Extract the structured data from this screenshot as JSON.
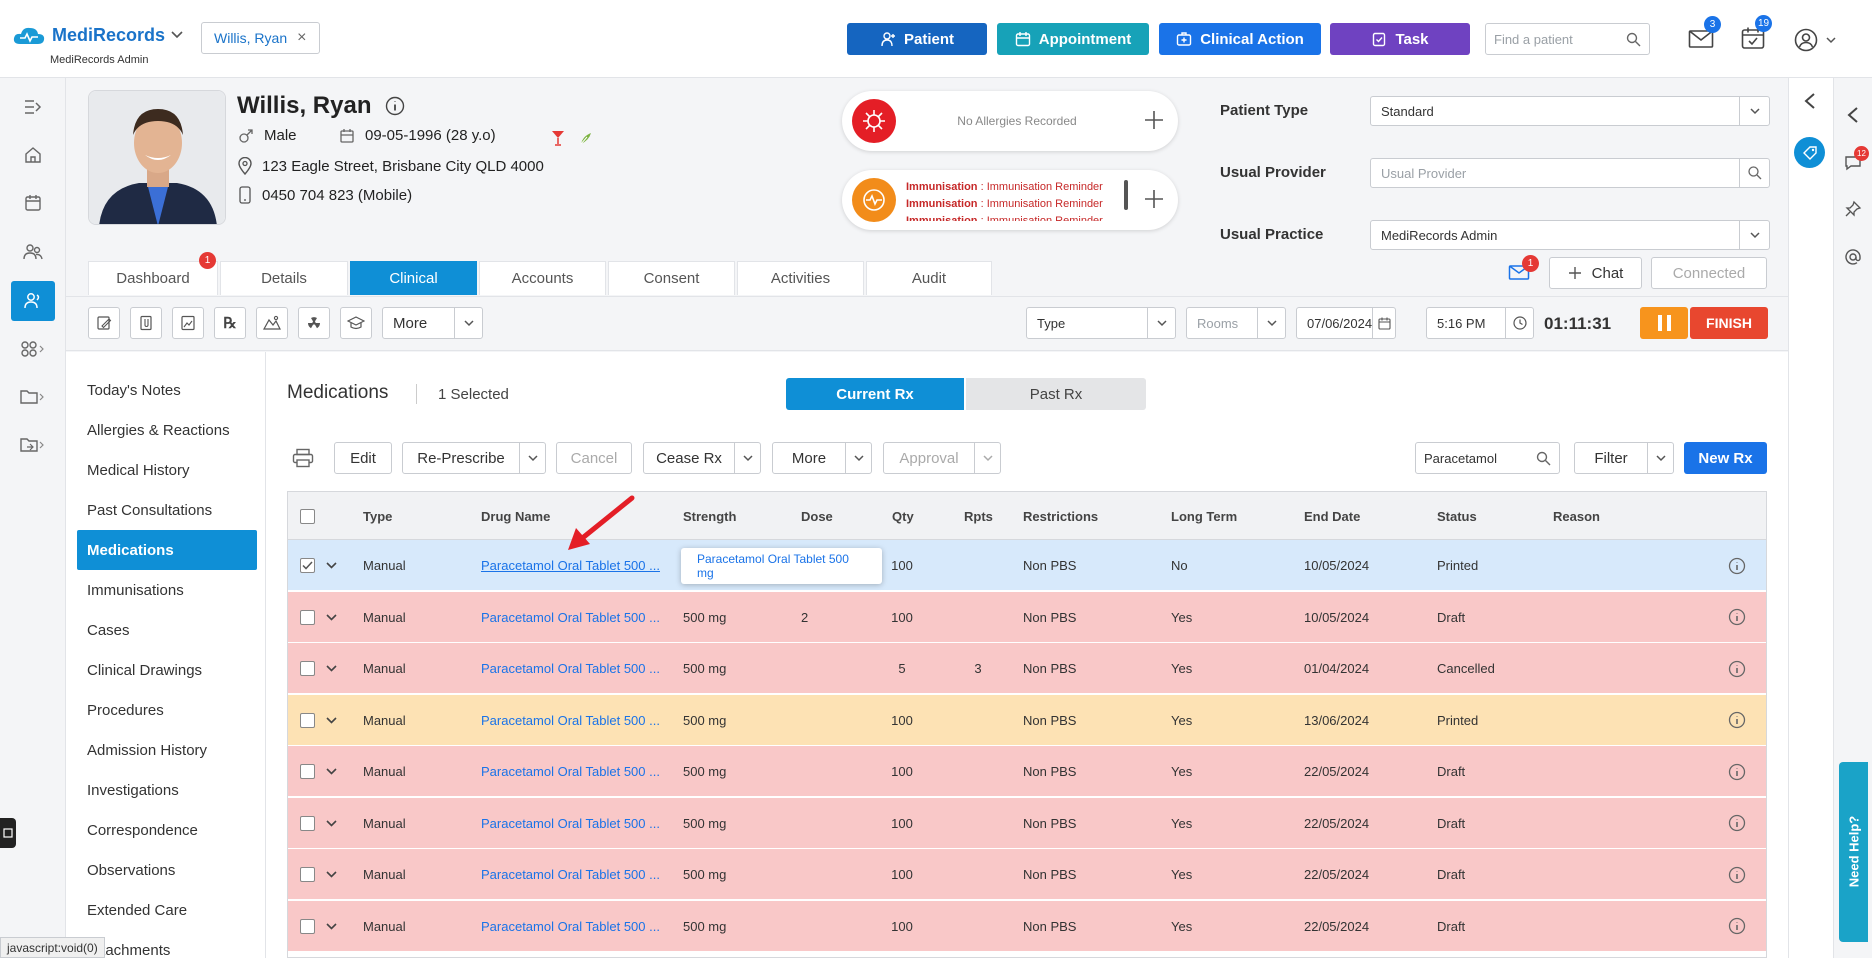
{
  "topbar": {
    "brand_name": "MediRecords",
    "brand_sub": "MediRecords Admin",
    "patient_chip": "Willis, Ryan",
    "buttons": {
      "patient": "Patient",
      "appointment": "Appointment",
      "clinical_action": "Clinical Action",
      "task": "Task"
    },
    "find_placeholder": "Find a patient",
    "mail_badge": "3",
    "tasks_badge": "19",
    "colors": {
      "patient": "#1565c0",
      "appointment": "#17a2b8",
      "clinical_action": "#1a73e8",
      "task": "#6f42c1"
    }
  },
  "patient": {
    "name": "Willis, Ryan",
    "gender": "Male",
    "dob": "09-05-1996 (28 y.o)",
    "address": "123 Eagle Street, Brisbane City QLD 4000",
    "phone": "0450 704 823 (Mobile)",
    "allergies_text": "No Allergies Recorded",
    "immunisation_label": "Immunisation",
    "immunisation_sep": " : ",
    "immunisation_text": "Immunisation Reminder",
    "form": {
      "patient_type_label": "Patient Type",
      "patient_type_value": "Standard",
      "usual_provider_label": "Usual Provider",
      "usual_provider_placeholder": "Usual Provider",
      "usual_practice_label": "Usual Practice",
      "usual_practice_value": "MediRecords Admin"
    }
  },
  "tabs": [
    {
      "label": "Dashboard",
      "badge": "1"
    },
    {
      "label": "Details"
    },
    {
      "label": "Clinical"
    },
    {
      "label": "Accounts"
    },
    {
      "label": "Consent"
    },
    {
      "label": "Activities"
    },
    {
      "label": "Audit"
    }
  ],
  "chat": {
    "inbox_badge": "1",
    "chat_label": "Chat",
    "connected_label": "Connected"
  },
  "toolbar": {
    "more_label": "More",
    "type_label": "Type",
    "rooms_label": "Rooms",
    "date": "07/06/2024",
    "time": "5:16 PM",
    "timer": "01:11:31",
    "finish_label": "FINISH"
  },
  "leftnav": [
    "Today's Notes",
    "Allergies & Reactions",
    "Medical History",
    "Past Consultations",
    "Medications",
    "Immunisations",
    "Cases",
    "Clinical Drawings",
    "Procedures",
    "Admission History",
    "Investigations",
    "Correspondence",
    "Observations",
    "Extended Care",
    "Attachments"
  ],
  "medications": {
    "title": "Medications",
    "selected": "1 Selected",
    "current_rx": "Current Rx",
    "past_rx": "Past Rx",
    "actions": {
      "edit": "Edit",
      "represcribe": "Re-Prescribe",
      "cancel": "Cancel",
      "cease": "Cease Rx",
      "more": "More",
      "approval": "Approval",
      "filter": "Filter",
      "new_rx": "New Rx"
    },
    "search_value": "Paracetamol",
    "columns": [
      "Type",
      "Drug Name",
      "Strength",
      "Dose",
      "Qty",
      "Rpts",
      "Restrictions",
      "Long Term",
      "End Date",
      "Status",
      "Reason"
    ],
    "tooltip": "Paracetamol Oral Tablet 500 mg",
    "rows": [
      {
        "type": "Manual",
        "drug": "Paracetamol Oral Tablet 500 ...",
        "strength": "",
        "dose": "",
        "qty": "100",
        "rpts": "",
        "restrictions": "Non PBS",
        "long_term": "No",
        "end_date": "10/05/2024",
        "status": "Printed",
        "bg": "#d7e9fb",
        "checked": true
      },
      {
        "type": "Manual",
        "drug": "Paracetamol Oral Tablet 500 ...",
        "strength": "500 mg",
        "dose": "2",
        "qty": "100",
        "rpts": "",
        "restrictions": "Non PBS",
        "long_term": "Yes",
        "end_date": "10/05/2024",
        "status": "Draft",
        "bg": "#f9c8c8"
      },
      {
        "type": "Manual",
        "drug": "Paracetamol Oral Tablet 500 ...",
        "strength": "500 mg",
        "dose": "",
        "qty": "5",
        "rpts": "3",
        "restrictions": "Non PBS",
        "long_term": "Yes",
        "end_date": "01/04/2024",
        "status": "Cancelled",
        "bg": "#f9c8c8"
      },
      {
        "type": "Manual",
        "drug": "Paracetamol Oral Tablet 500 ...",
        "strength": "500 mg",
        "dose": "",
        "qty": "100",
        "rpts": "",
        "restrictions": "Non PBS",
        "long_term": "Yes",
        "end_date": "13/06/2024",
        "status": "Printed",
        "bg": "#fde2b4"
      },
      {
        "type": "Manual",
        "drug": "Paracetamol Oral Tablet 500 ...",
        "strength": "500 mg",
        "dose": "",
        "qty": "100",
        "rpts": "",
        "restrictions": "Non PBS",
        "long_term": "Yes",
        "end_date": "22/05/2024",
        "status": "Draft",
        "bg": "#f9c8c8"
      },
      {
        "type": "Manual",
        "drug": "Paracetamol Oral Tablet 500 ...",
        "strength": "500 mg",
        "dose": "",
        "qty": "100",
        "rpts": "",
        "restrictions": "Non PBS",
        "long_term": "Yes",
        "end_date": "22/05/2024",
        "status": "Draft",
        "bg": "#f9c8c8"
      },
      {
        "type": "Manual",
        "drug": "Paracetamol Oral Tablet 500 ...",
        "strength": "500 mg",
        "dose": "",
        "qty": "100",
        "rpts": "",
        "restrictions": "Non PBS",
        "long_term": "Yes",
        "end_date": "22/05/2024",
        "status": "Draft",
        "bg": "#f9c8c8"
      },
      {
        "type": "Manual",
        "drug": "Paracetamol Oral Tablet 500 ...",
        "strength": "500 mg",
        "dose": "",
        "qty": "100",
        "rpts": "",
        "restrictions": "Non PBS",
        "long_term": "Yes",
        "end_date": "22/05/2024",
        "status": "Draft",
        "bg": "#f9c8c8"
      }
    ]
  },
  "sidebar_right": {
    "comments_badge": "12",
    "need_help": "Need Help?"
  },
  "statusbar": "javascript:void(0)"
}
